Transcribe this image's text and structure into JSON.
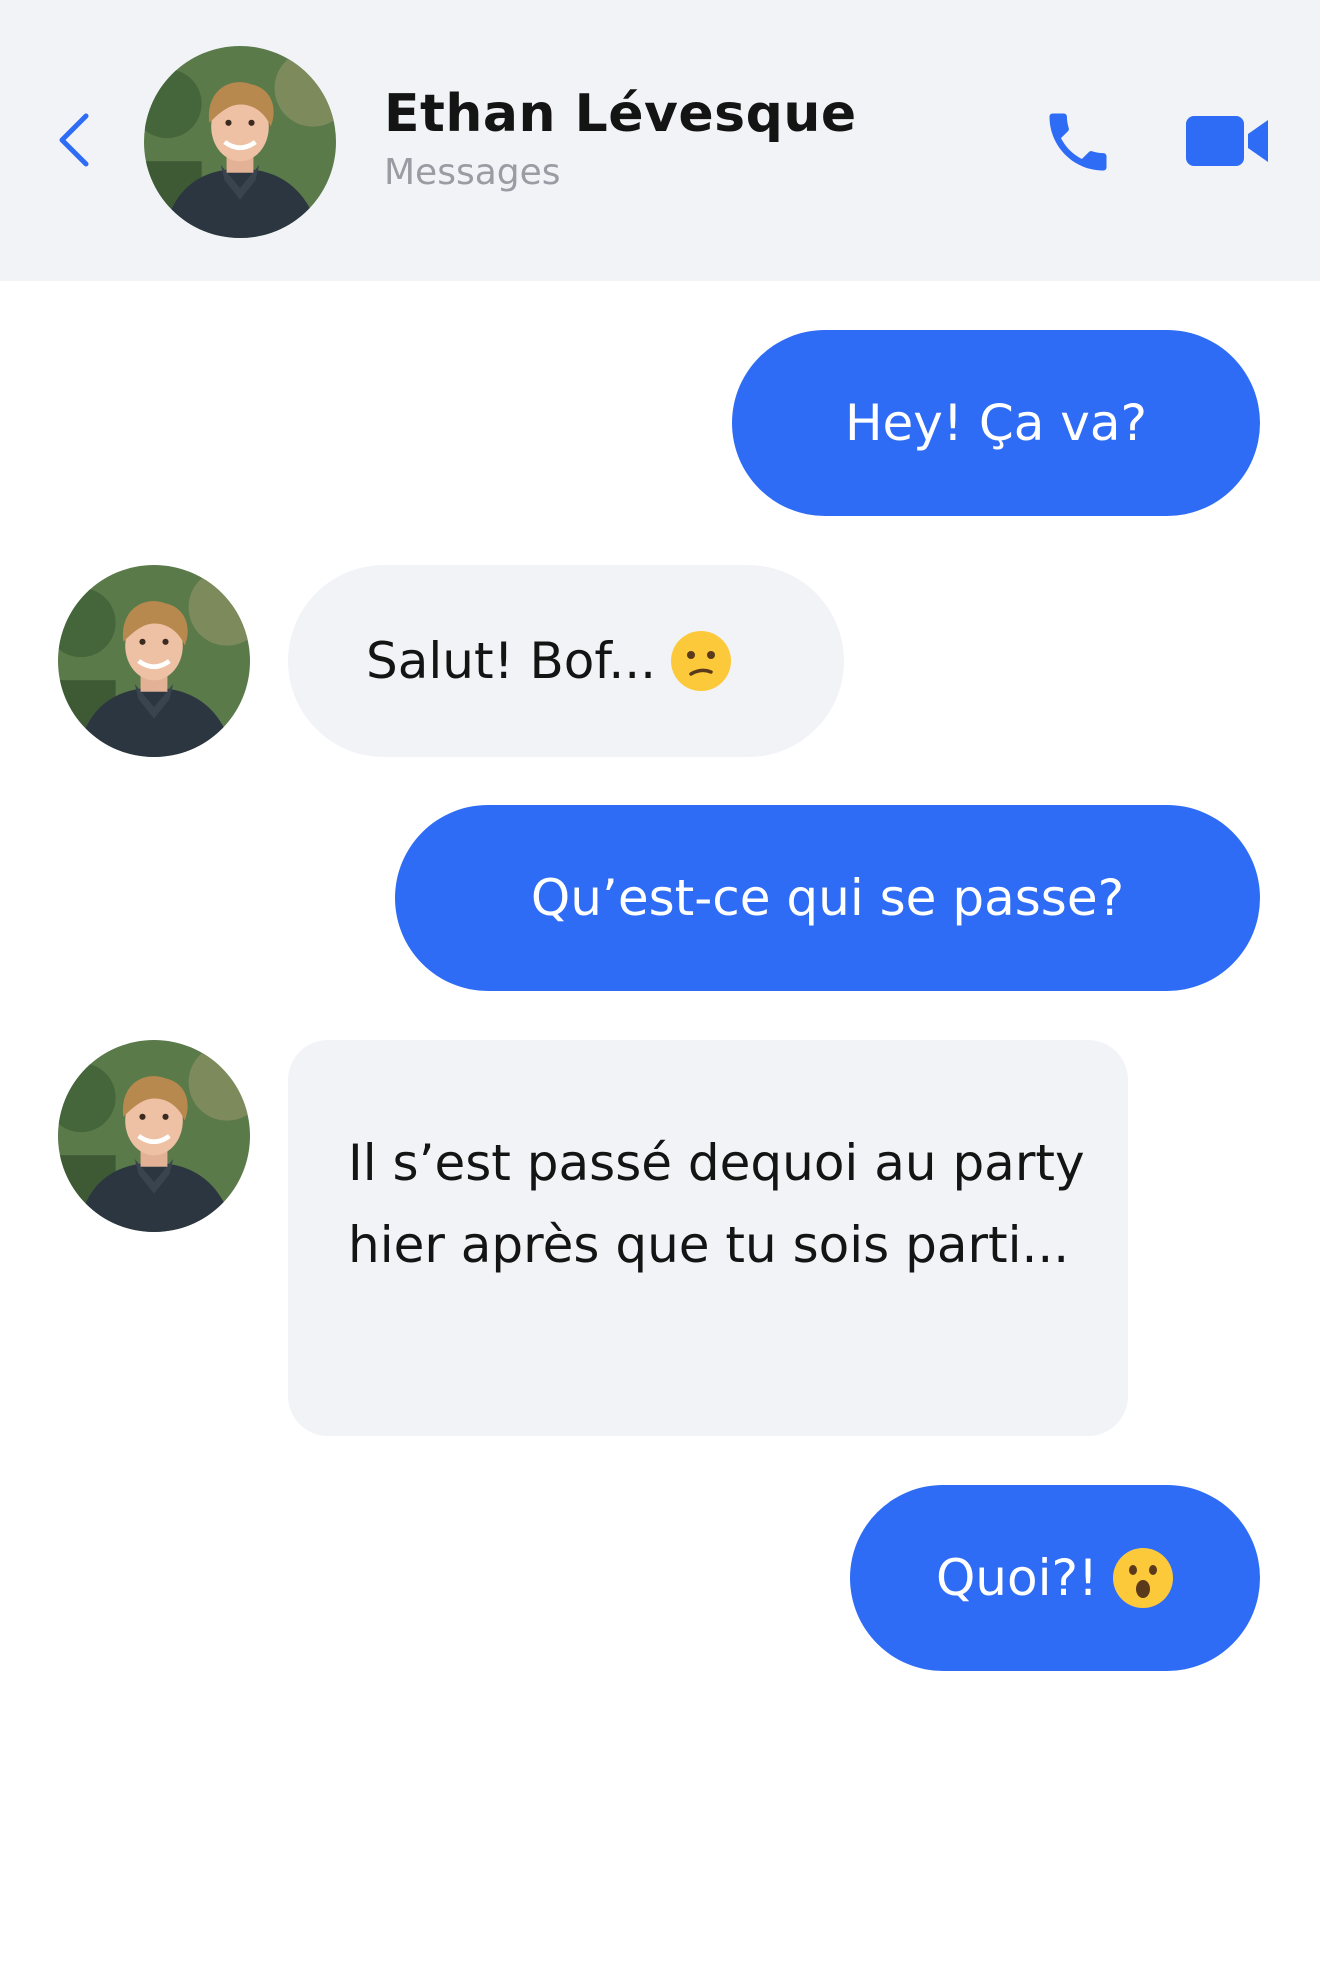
{
  "header": {
    "contact_name": "Ethan Lévesque",
    "subtitle": "Messages",
    "back_icon": "chevron-left-icon",
    "call_icon": "phone-icon",
    "video_icon": "video-camera-icon"
  },
  "colors": {
    "accent": "#2f6cf6",
    "header_bg": "#f1f3f7",
    "incoming_bubble": "#f1f3f7",
    "name_text": "#141414",
    "subtitle_text": "#9a9ca3"
  },
  "messages": [
    {
      "direction": "outgoing",
      "text": "Hey! Ça va?"
    },
    {
      "direction": "incoming",
      "text": "Salut! Bof...",
      "emoji": "confused-face-emoji"
    },
    {
      "direction": "outgoing",
      "text": "Qu’est-ce qui se passe?"
    },
    {
      "direction": "incoming",
      "text": "Il s’est passé dequoi au party hier après que tu sois parti..."
    },
    {
      "direction": "outgoing",
      "text": "Quoi?!",
      "emoji": "surprised-face-emoji"
    }
  ]
}
